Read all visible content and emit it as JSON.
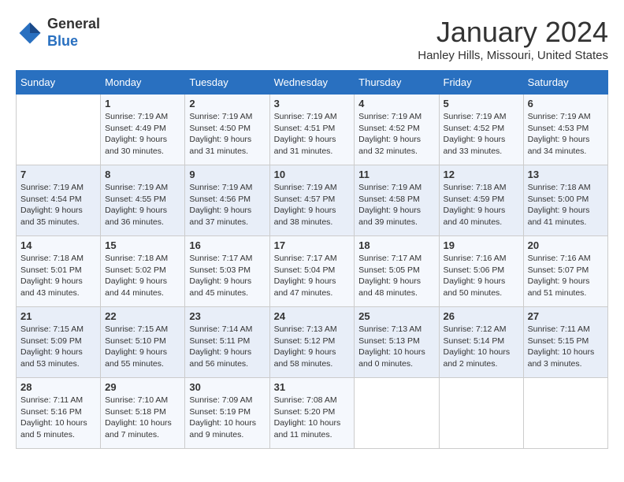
{
  "header": {
    "logo_line1": "General",
    "logo_line2": "Blue",
    "month": "January 2024",
    "location": "Hanley Hills, Missouri, United States"
  },
  "weekdays": [
    "Sunday",
    "Monday",
    "Tuesday",
    "Wednesday",
    "Thursday",
    "Friday",
    "Saturday"
  ],
  "weeks": [
    [
      {
        "day": "",
        "info": ""
      },
      {
        "day": "1",
        "info": "Sunrise: 7:19 AM\nSunset: 4:49 PM\nDaylight: 9 hours\nand 30 minutes."
      },
      {
        "day": "2",
        "info": "Sunrise: 7:19 AM\nSunset: 4:50 PM\nDaylight: 9 hours\nand 31 minutes."
      },
      {
        "day": "3",
        "info": "Sunrise: 7:19 AM\nSunset: 4:51 PM\nDaylight: 9 hours\nand 31 minutes."
      },
      {
        "day": "4",
        "info": "Sunrise: 7:19 AM\nSunset: 4:52 PM\nDaylight: 9 hours\nand 32 minutes."
      },
      {
        "day": "5",
        "info": "Sunrise: 7:19 AM\nSunset: 4:52 PM\nDaylight: 9 hours\nand 33 minutes."
      },
      {
        "day": "6",
        "info": "Sunrise: 7:19 AM\nSunset: 4:53 PM\nDaylight: 9 hours\nand 34 minutes."
      }
    ],
    [
      {
        "day": "7",
        "info": "Sunrise: 7:19 AM\nSunset: 4:54 PM\nDaylight: 9 hours\nand 35 minutes."
      },
      {
        "day": "8",
        "info": "Sunrise: 7:19 AM\nSunset: 4:55 PM\nDaylight: 9 hours\nand 36 minutes."
      },
      {
        "day": "9",
        "info": "Sunrise: 7:19 AM\nSunset: 4:56 PM\nDaylight: 9 hours\nand 37 minutes."
      },
      {
        "day": "10",
        "info": "Sunrise: 7:19 AM\nSunset: 4:57 PM\nDaylight: 9 hours\nand 38 minutes."
      },
      {
        "day": "11",
        "info": "Sunrise: 7:19 AM\nSunset: 4:58 PM\nDaylight: 9 hours\nand 39 minutes."
      },
      {
        "day": "12",
        "info": "Sunrise: 7:18 AM\nSunset: 4:59 PM\nDaylight: 9 hours\nand 40 minutes."
      },
      {
        "day": "13",
        "info": "Sunrise: 7:18 AM\nSunset: 5:00 PM\nDaylight: 9 hours\nand 41 minutes."
      }
    ],
    [
      {
        "day": "14",
        "info": "Sunrise: 7:18 AM\nSunset: 5:01 PM\nDaylight: 9 hours\nand 43 minutes."
      },
      {
        "day": "15",
        "info": "Sunrise: 7:18 AM\nSunset: 5:02 PM\nDaylight: 9 hours\nand 44 minutes."
      },
      {
        "day": "16",
        "info": "Sunrise: 7:17 AM\nSunset: 5:03 PM\nDaylight: 9 hours\nand 45 minutes."
      },
      {
        "day": "17",
        "info": "Sunrise: 7:17 AM\nSunset: 5:04 PM\nDaylight: 9 hours\nand 47 minutes."
      },
      {
        "day": "18",
        "info": "Sunrise: 7:17 AM\nSunset: 5:05 PM\nDaylight: 9 hours\nand 48 minutes."
      },
      {
        "day": "19",
        "info": "Sunrise: 7:16 AM\nSunset: 5:06 PM\nDaylight: 9 hours\nand 50 minutes."
      },
      {
        "day": "20",
        "info": "Sunrise: 7:16 AM\nSunset: 5:07 PM\nDaylight: 9 hours\nand 51 minutes."
      }
    ],
    [
      {
        "day": "21",
        "info": "Sunrise: 7:15 AM\nSunset: 5:09 PM\nDaylight: 9 hours\nand 53 minutes."
      },
      {
        "day": "22",
        "info": "Sunrise: 7:15 AM\nSunset: 5:10 PM\nDaylight: 9 hours\nand 55 minutes."
      },
      {
        "day": "23",
        "info": "Sunrise: 7:14 AM\nSunset: 5:11 PM\nDaylight: 9 hours\nand 56 minutes."
      },
      {
        "day": "24",
        "info": "Sunrise: 7:13 AM\nSunset: 5:12 PM\nDaylight: 9 hours\nand 58 minutes."
      },
      {
        "day": "25",
        "info": "Sunrise: 7:13 AM\nSunset: 5:13 PM\nDaylight: 10 hours\nand 0 minutes."
      },
      {
        "day": "26",
        "info": "Sunrise: 7:12 AM\nSunset: 5:14 PM\nDaylight: 10 hours\nand 2 minutes."
      },
      {
        "day": "27",
        "info": "Sunrise: 7:11 AM\nSunset: 5:15 PM\nDaylight: 10 hours\nand 3 minutes."
      }
    ],
    [
      {
        "day": "28",
        "info": "Sunrise: 7:11 AM\nSunset: 5:16 PM\nDaylight: 10 hours\nand 5 minutes."
      },
      {
        "day": "29",
        "info": "Sunrise: 7:10 AM\nSunset: 5:18 PM\nDaylight: 10 hours\nand 7 minutes."
      },
      {
        "day": "30",
        "info": "Sunrise: 7:09 AM\nSunset: 5:19 PM\nDaylight: 10 hours\nand 9 minutes."
      },
      {
        "day": "31",
        "info": "Sunrise: 7:08 AM\nSunset: 5:20 PM\nDaylight: 10 hours\nand 11 minutes."
      },
      {
        "day": "",
        "info": ""
      },
      {
        "day": "",
        "info": ""
      },
      {
        "day": "",
        "info": ""
      }
    ]
  ]
}
